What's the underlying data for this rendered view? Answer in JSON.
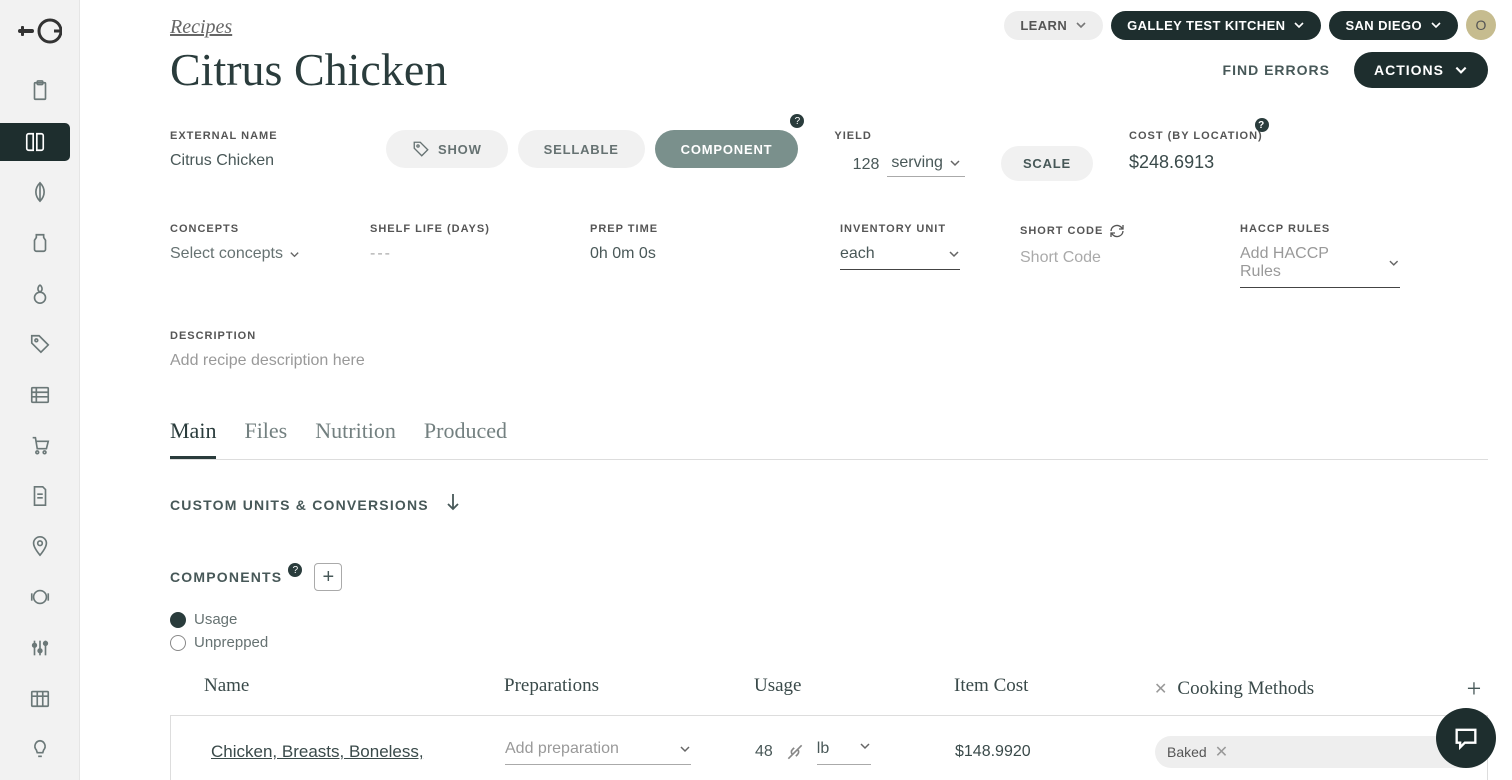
{
  "topbar": {
    "learn_label": "LEARN",
    "workspace": "GALLEY TEST KITCHEN",
    "location": "SAN DIEGO",
    "avatar_initial": "O"
  },
  "breadcrumb": "Recipes",
  "page_title": "Citrus Chicken",
  "title_actions": {
    "find_errors": "FIND ERRORS",
    "actions": "ACTIONS"
  },
  "external_name": {
    "label": "EXTERNAL NAME",
    "value": "Citrus Chicken"
  },
  "toggles": {
    "show": "SHOW",
    "sellable": "SELLABLE",
    "component": "COMPONENT"
  },
  "yield": {
    "label": "YIELD",
    "value": "128",
    "unit": "serving"
  },
  "scale_btn": "SCALE",
  "cost": {
    "label": "COST (BY LOCATION)",
    "value": "$248.6913"
  },
  "concepts": {
    "label": "CONCEPTS",
    "placeholder": "Select concepts"
  },
  "shelf_life": {
    "label": "SHELF LIFE (DAYS)",
    "placeholder": "---"
  },
  "prep_time": {
    "label": "PREP TIME",
    "value": "0h 0m 0s"
  },
  "inventory_unit": {
    "label": "INVENTORY UNIT",
    "value": "each"
  },
  "short_code": {
    "label": "SHORT CODE",
    "placeholder": "Short Code"
  },
  "haccp": {
    "label": "HACCP RULES",
    "placeholder": "Add HACCP Rules"
  },
  "description": {
    "label": "DESCRIPTION",
    "placeholder": "Add recipe description here"
  },
  "tabs": {
    "main": "Main",
    "files": "Files",
    "nutrition": "Nutrition",
    "produced": "Produced"
  },
  "custom_units_label": "CUSTOM UNITS & CONVERSIONS",
  "components": {
    "heading": "COMPONENTS",
    "usage_label": "Usage",
    "unprepped_label": "Unprepped",
    "columns": {
      "name": "Name",
      "preparations": "Preparations",
      "usage": "Usage",
      "item_cost": "Item Cost",
      "cooking_methods": "Cooking Methods"
    },
    "rows": [
      {
        "name": "Chicken, Breasts, Boneless,",
        "prep_placeholder": "Add preparation",
        "qty": "48",
        "unit": "lb",
        "item_cost": "$148.9920",
        "cooking_tag": "Baked"
      }
    ]
  }
}
